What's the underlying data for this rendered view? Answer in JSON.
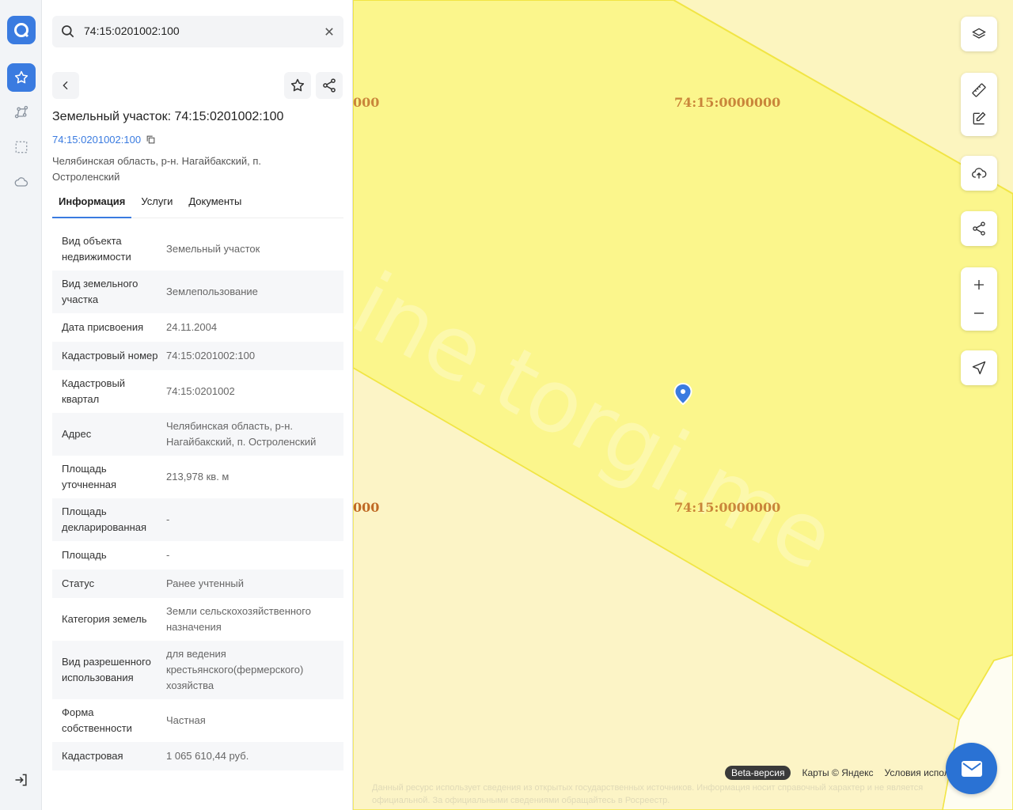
{
  "search": {
    "value": "74:15:0201002:100"
  },
  "parcel": {
    "title": "Земельный участок: 74:15:0201002:100",
    "cadastral_link": "74:15:0201002:100",
    "address": "Челябинская область, р-н. Нагайбакский, п. Остроленский"
  },
  "tabs": [
    "Информация",
    "Услуги",
    "Документы"
  ],
  "active_tab": "Информация",
  "info_rows": [
    {
      "key": "Вид объекта недвижимости",
      "value": "Земельный участок"
    },
    {
      "key": "Вид земельного участка",
      "value": "Землепользование"
    },
    {
      "key": "Дата присвоения",
      "value": "24.11.2004"
    },
    {
      "key": "Кадастровый номер",
      "value": "74:15:0201002:100"
    },
    {
      "key": "Кадастровый квартал",
      "value": "74:15:0201002"
    },
    {
      "key": "Адрес",
      "value": "Челябинская область, р-н. Нагайбакский, п. Остроленский"
    },
    {
      "key": "Площадь уточненная",
      "value": "213,978 кв. м"
    },
    {
      "key": "Площадь декларированная",
      "value": "-"
    },
    {
      "key": "Площадь",
      "value": "-"
    },
    {
      "key": "Статус",
      "value": "Ранее учтенный"
    },
    {
      "key": "Категория земель",
      "value": "Земли сельскохозяйственного назначения"
    },
    {
      "key": "Вид разрешенного использования",
      "value": "для ведения крестьянского(фермерского) хозяйства"
    },
    {
      "key": "Форма собственности",
      "value": "Частная"
    },
    {
      "key": "Кадастровая",
      "value": "1 065 610,44 руб."
    }
  ],
  "map": {
    "labels": [
      "000",
      "74:15:0000000",
      "000",
      "74:15:0000000"
    ],
    "watermark": "ine.torgi.me",
    "footer": {
      "beta": "Beta-версия",
      "copyright": "Карты © Яндекс",
      "terms": "Условия исполь"
    },
    "disclaimer": "Данный ресурс использует сведения из открытых государственных источников. Информация носит справочный характер и не является официальной. За официальными сведениями обращайтесь в Росреестр."
  },
  "colors": {
    "accent": "#3a7be0",
    "parcel_fill": "#fbf68c",
    "map_bg": "#fdf8d2"
  },
  "icons": {
    "rail": [
      "logo-icon",
      "star-icon",
      "route-icon",
      "selection-icon",
      "cloud-icon",
      "logout-icon"
    ],
    "map_controls": [
      "layers-icon",
      "ruler-icon",
      "edit-icon",
      "upload-icon",
      "share-icon",
      "zoom-in-icon",
      "zoom-out-icon",
      "locate-icon"
    ]
  }
}
